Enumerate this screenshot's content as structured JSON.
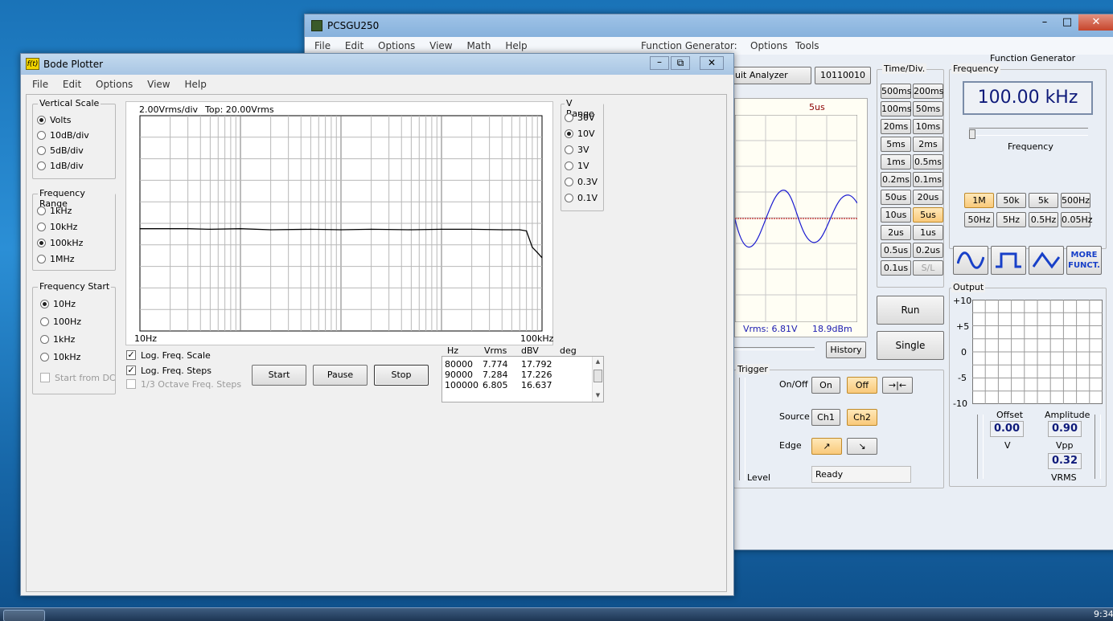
{
  "pcsgu": {
    "title": "PCSGU250",
    "menu": [
      "File",
      "Edit",
      "Options",
      "View",
      "Math",
      "Help"
    ],
    "fg_menu_label": "Function Generator:",
    "fg_menu": [
      "Options",
      "Tools"
    ],
    "tab_circuit": "uit Analyzer",
    "tab_binary": "10110010",
    "scope_time_label": "5us",
    "scope_vrms": "Vrms: 6.81V",
    "scope_dbm": "18.9dBm",
    "history": "History",
    "timediv_title": "Time/Div.",
    "timediv": [
      [
        "500ms",
        "200ms"
      ],
      [
        "100ms",
        "50ms"
      ],
      [
        "20ms",
        "10ms"
      ],
      [
        "5ms",
        "2ms"
      ],
      [
        "1ms",
        "0.5ms"
      ],
      [
        "0.2ms",
        "0.1ms"
      ],
      [
        "50us",
        "20us"
      ],
      [
        "10us",
        "5us"
      ],
      [
        "2us",
        "1us"
      ],
      [
        "0.5us",
        "0.2us"
      ],
      [
        "0.1us",
        "S/L"
      ]
    ],
    "timediv_selected": "5us",
    "run": "Run",
    "single": "Single",
    "trigger": {
      "title": "Trigger",
      "onoff_label": "On/Off",
      "on": "On",
      "off": "Off",
      "source_label": "Source",
      "ch1": "Ch1",
      "ch2": "Ch2",
      "edge_label": "Edge",
      "level_label": "Level",
      "status": "Ready"
    }
  },
  "fg": {
    "title": "Function Generator",
    "freq_group": "Frequency",
    "freq_display": "100.00 kHz",
    "freq_slider_label": "Frequency",
    "ranges": [
      "1M",
      "50k",
      "5k",
      "500Hz",
      "50Hz",
      "5Hz",
      "0.5Hz",
      "0.05Hz"
    ],
    "range_selected": "1M",
    "more": "MORE FUNCT.",
    "output_title": "Output",
    "output_ticks": [
      "+10",
      "+5",
      "0",
      "-5",
      "-10"
    ],
    "offset_label": "Offset",
    "offset_value": "0.00",
    "offset_unit": "V",
    "amplitude_label": "Amplitude",
    "amplitude_value": "0.90",
    "amplitude_unit": "Vpp",
    "vrms_value": "0.32",
    "vrms_unit": "VRMS"
  },
  "bode": {
    "title": "Bode Plotter",
    "menu": [
      "File",
      "Edit",
      "Options",
      "View",
      "Help"
    ],
    "vscale_title": "Vertical Scale",
    "vscale": [
      "Volts",
      "10dB/div",
      "5dB/div",
      "1dB/div"
    ],
    "vscale_selected": "Volts",
    "frange_title": "Frequency Range",
    "frange": [
      "1kHz",
      "10kHz",
      "100kHz",
      "1MHz"
    ],
    "frange_selected": "100kHz",
    "fstart_title": "Frequency Start",
    "fstart": [
      "10Hz",
      "100Hz",
      "1kHz",
      "10kHz"
    ],
    "fstart_selected": "10Hz",
    "start_dc": "Start from DC",
    "plot_scale": "2.00Vrms/div",
    "plot_top": "Top: 20.00Vrms",
    "x_start": "10Hz",
    "x_end": "100kHz",
    "vrange_title": "V Range",
    "vrange": [
      "30V",
      "10V",
      "3V",
      "1V",
      "0.3V",
      "0.1V"
    ],
    "vrange_selected": "10V",
    "log_scale": "Log. Freq. Scale",
    "log_steps": "Log. Freq. Steps",
    "octave": "1/3 Octave Freq. Steps",
    "start": "Start",
    "pause": "Pause",
    "stop": "Stop",
    "table_headers": [
      "Hz",
      "Vrms",
      "dBV",
      "deg"
    ],
    "table_rows": [
      [
        "80000",
        "7.774",
        "17.792",
        ""
      ],
      [
        "90000",
        "7.284",
        "17.226",
        ""
      ],
      [
        "100000",
        "6.805",
        "16.637",
        ""
      ]
    ]
  },
  "taskbar": {
    "clock": "9:34"
  },
  "chart_data": {
    "type": "line",
    "x_scale": "log",
    "xlim": [
      10,
      100000
    ],
    "ylim": [
      0,
      20
    ],
    "ylabel": "2.00Vrms/div",
    "series": [
      {
        "x": [
          10,
          20,
          30,
          50,
          100,
          200,
          500,
          1000,
          2000,
          5000,
          10000,
          20000,
          40000,
          60000,
          70000,
          80000,
          90000,
          100000
        ],
        "values": [
          9.5,
          9.5,
          9.5,
          9.45,
          9.5,
          9.4,
          9.45,
          9.4,
          9.45,
          9.4,
          9.45,
          9.45,
          9.4,
          9.4,
          9.3,
          7.774,
          7.284,
          6.805
        ]
      }
    ]
  }
}
